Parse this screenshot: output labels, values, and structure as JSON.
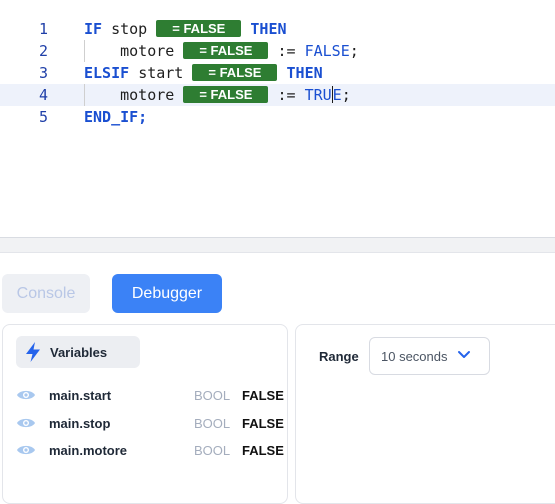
{
  "editor": {
    "lines": [
      {
        "num": "1"
      },
      {
        "num": "2"
      },
      {
        "num": "3"
      },
      {
        "num": "4"
      },
      {
        "num": "5"
      }
    ],
    "kw_if": "IF",
    "id_stop": "stop",
    "kw_then": "THEN",
    "id_motore": "motore",
    "op_assign": ":=",
    "val_false": "FALSE",
    "semicolon": ";",
    "kw_elsif": "ELSIF",
    "id_start": "start",
    "val_true_a": "TRU",
    "val_true_b": "E",
    "kw_end_if": "END_IF;",
    "badge_text": "= FALSE"
  },
  "tabs": {
    "console": "Console",
    "debugger": "Debugger"
  },
  "variables": {
    "title": "Variables",
    "items": [
      {
        "name": "main.start",
        "type": "BOOL",
        "value": "FALSE"
      },
      {
        "name": "main.stop",
        "type": "BOOL",
        "value": "FALSE"
      },
      {
        "name": "main.motore",
        "type": "BOOL",
        "value": "FALSE"
      }
    ]
  },
  "range": {
    "label": "Range",
    "value": "10 seconds"
  },
  "icons": {
    "variables": "lightning-bolt-icon",
    "watch": "eye-icon",
    "dropdown": "chevron-down-icon"
  },
  "colors": {
    "keyword": "#1a4fd1",
    "badge": "#2e7d32",
    "accent": "#3b82f6"
  }
}
